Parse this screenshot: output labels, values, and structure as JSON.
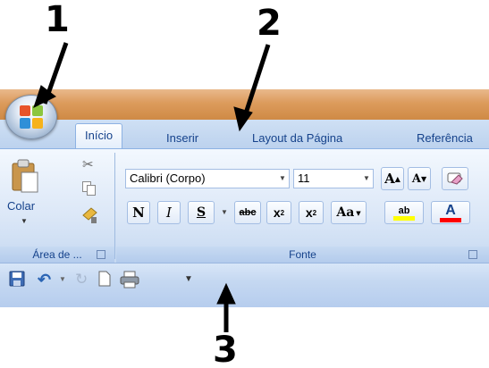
{
  "annotations": {
    "n1": "1",
    "n2": "2",
    "n3": "3"
  },
  "tabs": {
    "inicio": "Início",
    "inserir": "Inserir",
    "layout": "Layout da Página",
    "referencias": "Referência"
  },
  "clipboard": {
    "paste_label": "Colar",
    "group_label": "Área de ...",
    "launcher_icon": "dialog-launcher-icon"
  },
  "font": {
    "family_value": "Calibri (Corpo)",
    "size_value": "11",
    "grow_label": "A",
    "shrink_label": "A",
    "bold_label": "N",
    "italic_label": "I",
    "underline_label": "S",
    "strike_label": "abc",
    "subscript_label": "x",
    "subscript_mark": "2",
    "superscript_label": "x",
    "superscript_mark": "2",
    "case_label": "Aa",
    "highlight_label": "ab",
    "color_label": "A",
    "group_label": "Fonte"
  },
  "colors": {
    "accent": "#15428b",
    "highlight": "#ffff00",
    "font_color": "#ff0000"
  }
}
